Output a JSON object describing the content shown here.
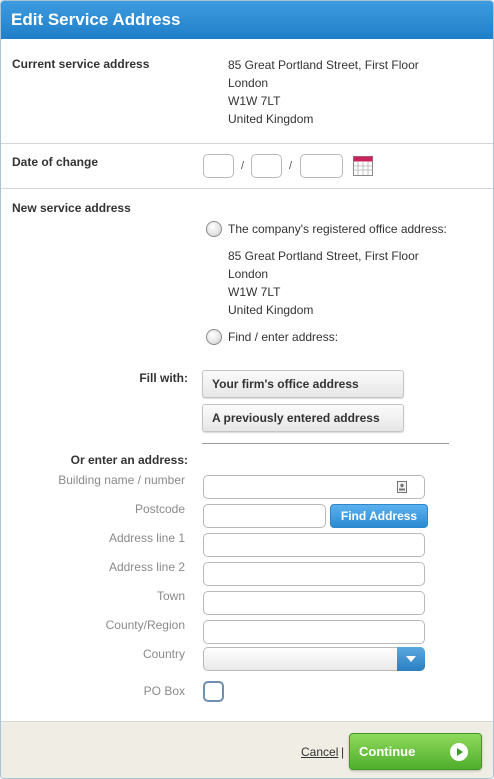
{
  "dialog": {
    "title": "Edit Service Address"
  },
  "current": {
    "label": "Current service address",
    "lines": [
      "85 Great Portland Street, First Floor",
      "London",
      "W1W 7LT",
      "United Kingdom"
    ]
  },
  "date": {
    "label": "Date of change",
    "separator": "/",
    "day": "",
    "month": "",
    "year": ""
  },
  "new_address": {
    "label": "New service address",
    "option_registered": "The company's registered office address:",
    "registered_lines": [
      "85 Great Portland Street, First Floor",
      "London",
      "W1W 7LT",
      "United Kingdom"
    ],
    "option_find": "Find / enter address:"
  },
  "fill": {
    "label": "Fill with:",
    "firm_button": "Your firm's office address",
    "previous_button": "A previously entered address"
  },
  "manual": {
    "label": "Or enter an address:",
    "building_label": "Building name / number",
    "postcode_label": "Postcode",
    "find_button": "Find Address",
    "line1_label": "Address line 1",
    "line2_label": "Address line 2",
    "town_label": "Town",
    "county_label": "County/Region",
    "country_label": "Country",
    "country_value": "",
    "pobox_label": "PO Box"
  },
  "footer": {
    "cancel": "Cancel",
    "pipe": "|",
    "continue": "Continue"
  },
  "colors": {
    "title_bar": "#2a8bd4",
    "continue": "#5fbb35",
    "find": "#3a95db"
  }
}
